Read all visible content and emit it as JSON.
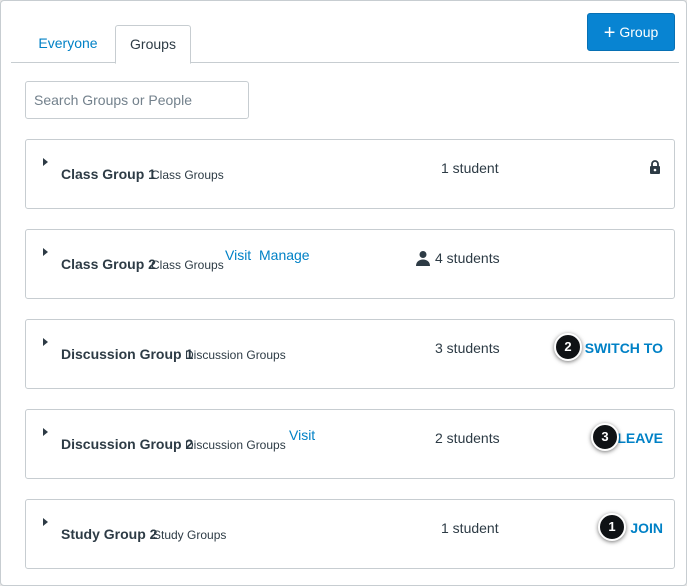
{
  "tabs": [
    {
      "label": "Everyone"
    },
    {
      "label": "Groups"
    }
  ],
  "add_group_button": {
    "icon": "plus-icon",
    "label": "Group"
  },
  "search": {
    "placeholder": "Search Groups or People",
    "value": ""
  },
  "groups": [
    {
      "name": "Class Group 1",
      "category": "Class Groups",
      "count": "1 student",
      "lock_icon": "lock-icon"
    },
    {
      "name": "Class Group 2",
      "category": "Class Groups",
      "links": [
        "Visit",
        "Manage"
      ],
      "count": "4 students",
      "count_icon": "person-icon"
    },
    {
      "name": "Discussion Group 1",
      "category": "Discussion Groups",
      "count": "3 students",
      "action": "SWITCH TO",
      "callout": "2"
    },
    {
      "name": "Discussion Group 2",
      "category": "Discussion Groups",
      "links": [
        "Visit"
      ],
      "count": "2 students",
      "action": "LEAVE",
      "callout": "3"
    },
    {
      "name": "Study Group 2",
      "category": "Study Groups",
      "count": "1 student",
      "action": "JOIN",
      "callout": "1"
    }
  ],
  "colors": {
    "link": "#0081c6",
    "primary_button": "#0884d2",
    "text": "#2d3b45",
    "border": "#c7cdd1",
    "callout": "#0f1215"
  }
}
